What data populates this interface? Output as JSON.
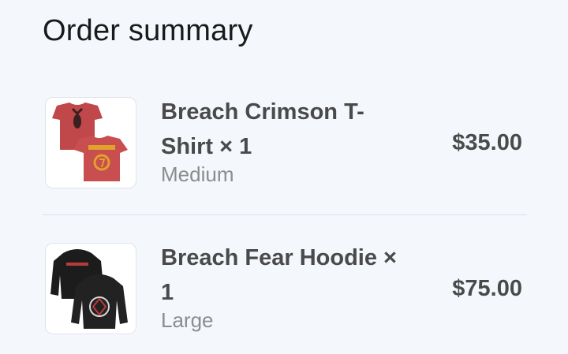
{
  "order_summary": {
    "title": "Order summary",
    "items": [
      {
        "name": "Breach Crimson T-Shirt",
        "quantity_text": "× 1",
        "variant": "Medium",
        "price": "$35.00",
        "thumbnail_icon": "red-tshirt-image",
        "colors": {
          "garment": "#c0474a",
          "print": "#e0a22a"
        }
      },
      {
        "name": "Breach Fear Hoodie",
        "quantity_text": "× 1",
        "variant": "Large",
        "price": "$75.00",
        "thumbnail_icon": "black-hoodie-image",
        "colors": {
          "garment": "#1a1a1a",
          "print": "#b83a3a"
        }
      }
    ]
  }
}
